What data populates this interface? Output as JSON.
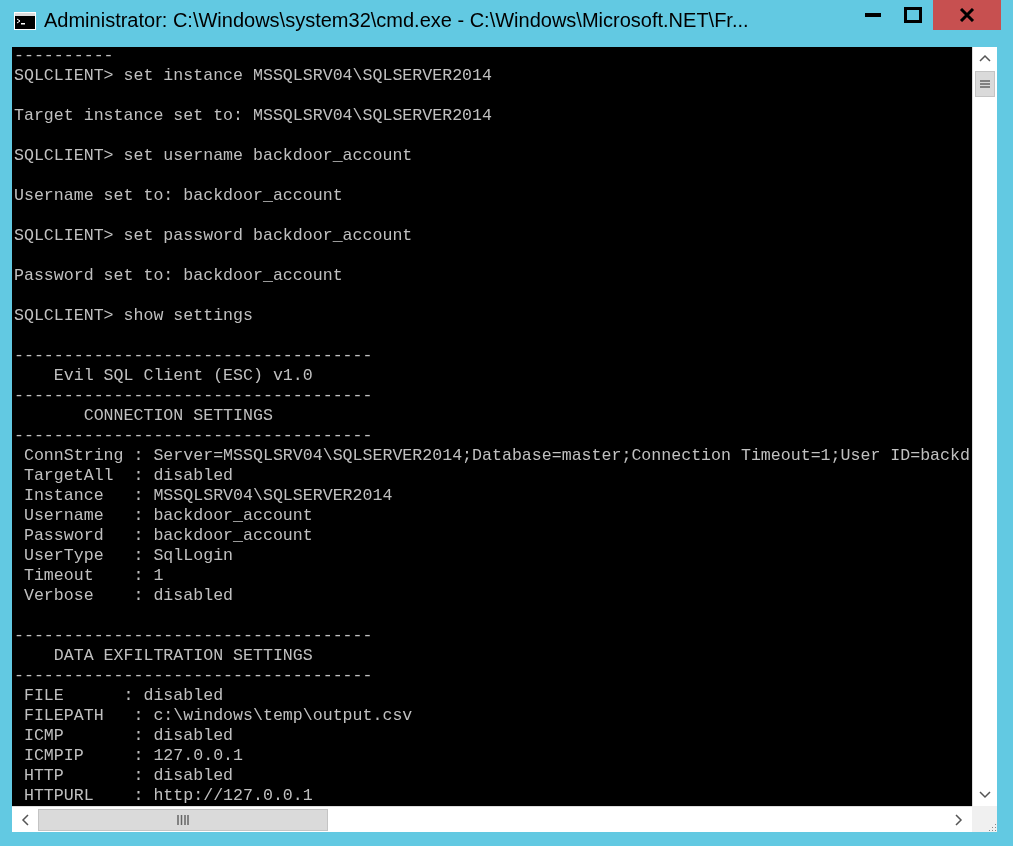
{
  "window": {
    "title": "Administrator: C:\\Windows\\system32\\cmd.exe - C:\\Windows\\Microsoft.NET\\Fr..."
  },
  "console": {
    "blocks": [
      {
        "lines": [
          "----------",
          "SQLCLIENT> set instance MSSQLSRV04\\SQLSERVER2014"
        ]
      },
      {
        "lines": [
          "Target instance set to: MSSQLSRV04\\SQLSERVER2014"
        ]
      },
      {
        "lines": [
          "SQLCLIENT> set username backdoor_account"
        ]
      },
      {
        "lines": [
          "Username set to: backdoor_account"
        ]
      },
      {
        "lines": [
          "SQLCLIENT> set password backdoor_account"
        ]
      },
      {
        "lines": [
          "Password set to: backdoor_account"
        ]
      },
      {
        "lines": [
          "SQLCLIENT> show settings"
        ]
      },
      {
        "lines": [
          "------------------------------------",
          "    Evil SQL Client (ESC) v1.0",
          "------------------------------------",
          "       CONNECTION SETTINGS",
          "------------------------------------",
          " ConnString : Server=MSSQLSRV04\\SQLSERVER2014;Database=master;Connection Timeout=1;User ID=backd",
          " TargetAll  : disabled",
          " Instance   : MSSQLSRV04\\SQLSERVER2014",
          " Username   : backdoor_account",
          " Password   : backdoor_account",
          " UserType   : SqlLogin",
          " Timeout    : 1",
          " Verbose    : disabled"
        ]
      },
      {
        "lines": [
          "------------------------------------",
          "    DATA EXFILTRATION SETTINGS",
          "------------------------------------",
          " FILE      : disabled",
          " FILEPATH   : c:\\windows\\temp\\output.csv",
          " ICMP       : disabled",
          " ICMPIP     : 127.0.0.1",
          " HTTP       : disabled",
          " HTTPURL    : http://127.0.0.1"
        ]
      }
    ]
  }
}
